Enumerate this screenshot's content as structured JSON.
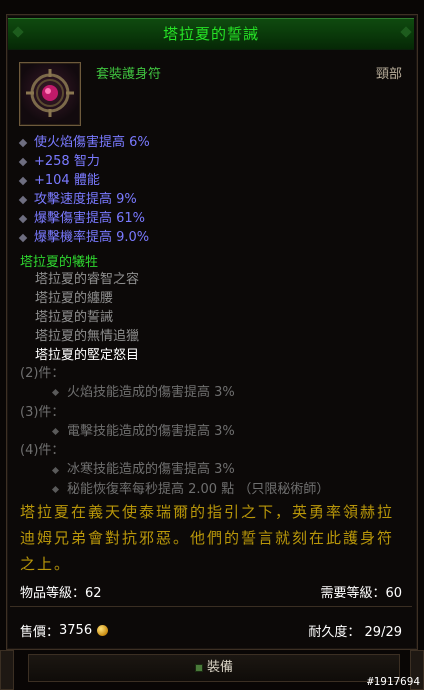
{
  "item": {
    "name": "塔拉夏的誓誡",
    "type": "套裝護身符",
    "slot": "頸部",
    "icon": "amulet-icon"
  },
  "affixes": [
    "使火焰傷害提高 6%",
    "+258 智力",
    "+104 體能",
    "攻擊速度提高 9%",
    "爆擊傷害提高 61%",
    "爆擊機率提高 9.0%"
  ],
  "set": {
    "name": "塔拉夏的犧牲",
    "pieces": [
      {
        "name": "塔拉夏的睿智之容",
        "equipped": false
      },
      {
        "name": "塔拉夏的纏腰",
        "equipped": false
      },
      {
        "name": "塔拉夏的誓誡",
        "equipped": false
      },
      {
        "name": "塔拉夏的無情追獵",
        "equipped": false
      },
      {
        "name": "塔拉夏的堅定怒目",
        "equipped": true
      }
    ],
    "bonuses": [
      {
        "label": "(2)件：",
        "effects": [
          "火焰技能造成的傷害提高 3%"
        ]
      },
      {
        "label": "(3)件：",
        "effects": [
          "電擊技能造成的傷害提高 3%"
        ]
      },
      {
        "label": "(4)件：",
        "effects": [
          "冰寒技能造成的傷害提高 3%",
          "秘能恢復率每秒提高 2.00 點 （只限秘術師）"
        ]
      }
    ]
  },
  "flavor": "塔拉夏在義天使泰瑞爾的指引之下，英勇率領赫拉迪姆兄弟會對抗邪惡。他們的誓言就刻在此護身符之上。",
  "stats": {
    "item_level": "物品等級：62",
    "required_level": "需要等級：60",
    "price_label": "售價：",
    "price_value": "3756",
    "durability": "耐久度： 29/29"
  },
  "equip_button": "裝備",
  "watermark": "#1917694",
  "colors": {
    "set_green": "#26e226",
    "magic_blue": "#7a7aff",
    "flavor_gold": "#b8960a",
    "inactive_gray": "#8f8f8f"
  }
}
